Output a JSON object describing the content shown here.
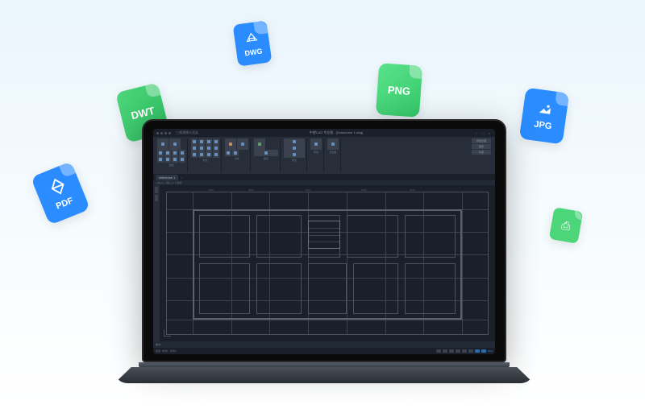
{
  "file_icons": {
    "pdf": {
      "label": "PDF",
      "glyph": "✦"
    },
    "dwt": {
      "label": "DWT"
    },
    "dwg": {
      "label": "DWG"
    },
    "png": {
      "label": "PNG"
    },
    "jpg": {
      "label": "JPG",
      "glyph": "▴"
    },
    "print": {
      "glyph": "⎙"
    }
  },
  "cad_app": {
    "title": "中望CAD 专业版 - [Drawhome 1.dwg]",
    "menu_hint": "三维建模与渲染",
    "tabs": [
      {
        "label": "reference 1",
        "active": true
      }
    ],
    "ribbon_groups": [
      {
        "label": "绘图"
      },
      {
        "label": "修改"
      },
      {
        "label": "注释"
      },
      {
        "label": "图层"
      },
      {
        "label": "属性"
      },
      {
        "label": "特性"
      },
      {
        "label": "剪贴板"
      }
    ],
    "right_panel_buttons": [
      {
        "label": "特性管理"
      },
      {
        "label": "图库"
      },
      {
        "label": "外部"
      },
      {
        "label": "管理外部参照"
      }
    ],
    "dimensions_top": [
      "3400",
      "3400",
      "7100",
      "6100",
      "6100"
    ],
    "command_prompt": "命令:",
    "coordinates": "x [输入] y [输入] z 0 坐标",
    "status_right_items": [
      "模型",
      "布局1",
      "布局2"
    ],
    "ucs_label": "UCS"
  }
}
